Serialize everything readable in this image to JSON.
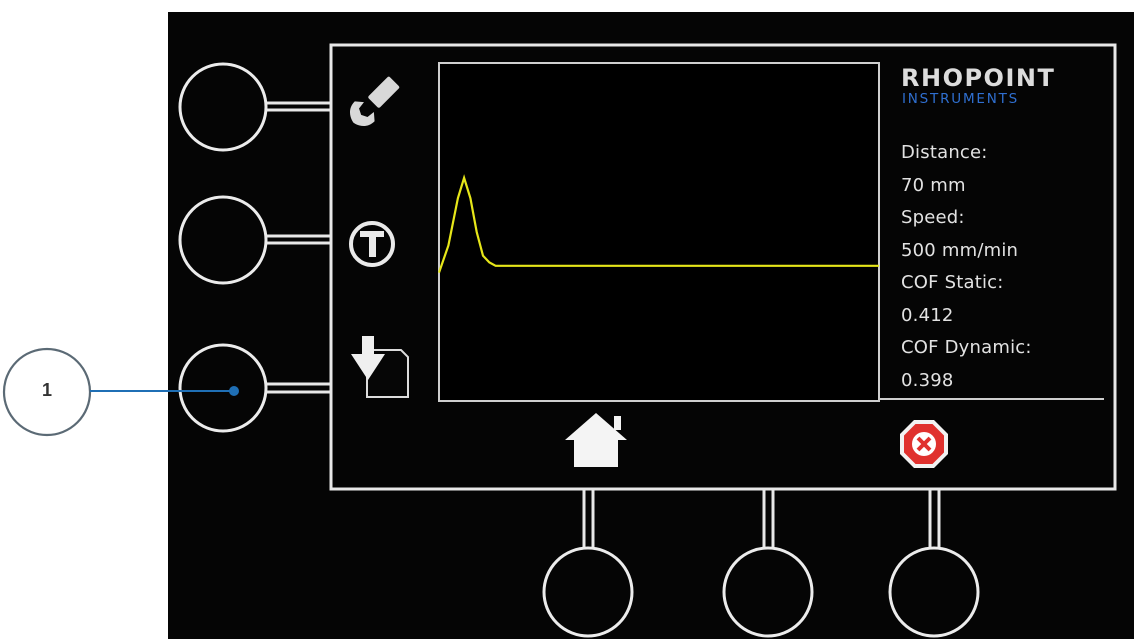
{
  "brand": {
    "name": "RHOPOINT",
    "subtitle": "INSTRUMENTS",
    "accent_color": "#2f6fd0"
  },
  "readouts": [
    {
      "key": "distance_label",
      "text": "Distance:"
    },
    {
      "key": "distance_value",
      "text": "70 mm"
    },
    {
      "key": "speed_label",
      "text": "Speed:"
    },
    {
      "key": "speed_value",
      "text": "500 mm/min"
    },
    {
      "key": "cof_static_label",
      "text": "COF Static:"
    },
    {
      "key": "cof_static_value",
      "text": "0.412"
    },
    {
      "key": "cof_dynamic_label",
      "text": "COF Dynamic:"
    },
    {
      "key": "cof_dynamic_value",
      "text": "0.398"
    }
  ],
  "side_icons": [
    "wrench-icon",
    "t-circle-icon",
    "save-document-icon"
  ],
  "bottom_icons": [
    "home-icon",
    "close-icon"
  ],
  "callout": {
    "label": "1",
    "color": "#1f6fb5"
  },
  "chart_data": {
    "type": "line",
    "title": "",
    "xlabel": "",
    "ylabel": "",
    "line_color": "#e6e619",
    "xlim": [
      0,
      70
    ],
    "ylim": [
      0,
      1
    ],
    "series": [
      {
        "x": [
          0,
          1.5,
          3,
          4,
          5,
          6,
          7,
          8,
          9,
          10,
          12,
          15,
          20,
          25,
          30,
          35,
          40,
          45,
          50,
          55,
          60,
          65,
          70
        ],
        "values": [
          0.38,
          0.46,
          0.6,
          0.66,
          0.6,
          0.5,
          0.43,
          0.41,
          0.4,
          0.4,
          0.4,
          0.4,
          0.4,
          0.4,
          0.4,
          0.4,
          0.4,
          0.4,
          0.4,
          0.4,
          0.4,
          0.4,
          0.4
        ]
      }
    ]
  }
}
